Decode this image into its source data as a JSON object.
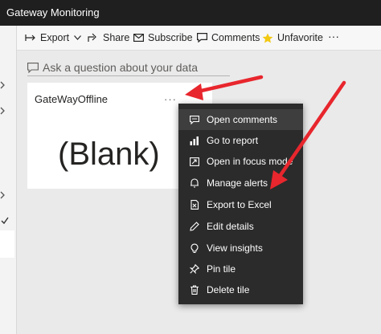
{
  "app": {
    "title": "Gateway Monitoring"
  },
  "toolbar": {
    "export": "Export",
    "share": "Share",
    "subscribe": "Subscribe",
    "comments": "Comments",
    "unfavorite": "Unfavorite",
    "more": "···"
  },
  "qa": {
    "placeholder": "Ask a question about your data"
  },
  "tile": {
    "title": "GateWayOffline",
    "value": "(Blank)",
    "more": "···"
  },
  "menu": {
    "items": [
      {
        "label": "Open comments",
        "icon": "comment-icon"
      },
      {
        "label": "Go to report",
        "icon": "bar-chart-icon"
      },
      {
        "label": "Open in focus mode",
        "icon": "focus-icon"
      },
      {
        "label": "Manage alerts",
        "icon": "bell-icon"
      },
      {
        "label": "Export to Excel",
        "icon": "excel-icon"
      },
      {
        "label": "Edit details",
        "icon": "pencil-icon"
      },
      {
        "label": "View insights",
        "icon": "lightbulb-icon"
      },
      {
        "label": "Pin tile",
        "icon": "pin-icon"
      },
      {
        "label": "Delete tile",
        "icon": "trash-icon"
      }
    ]
  },
  "colors": {
    "accent_star": "#f2c811",
    "arrow": "#e8262d",
    "menu_bg": "#2b2b2b",
    "titlebar": "#1f1f1f"
  }
}
